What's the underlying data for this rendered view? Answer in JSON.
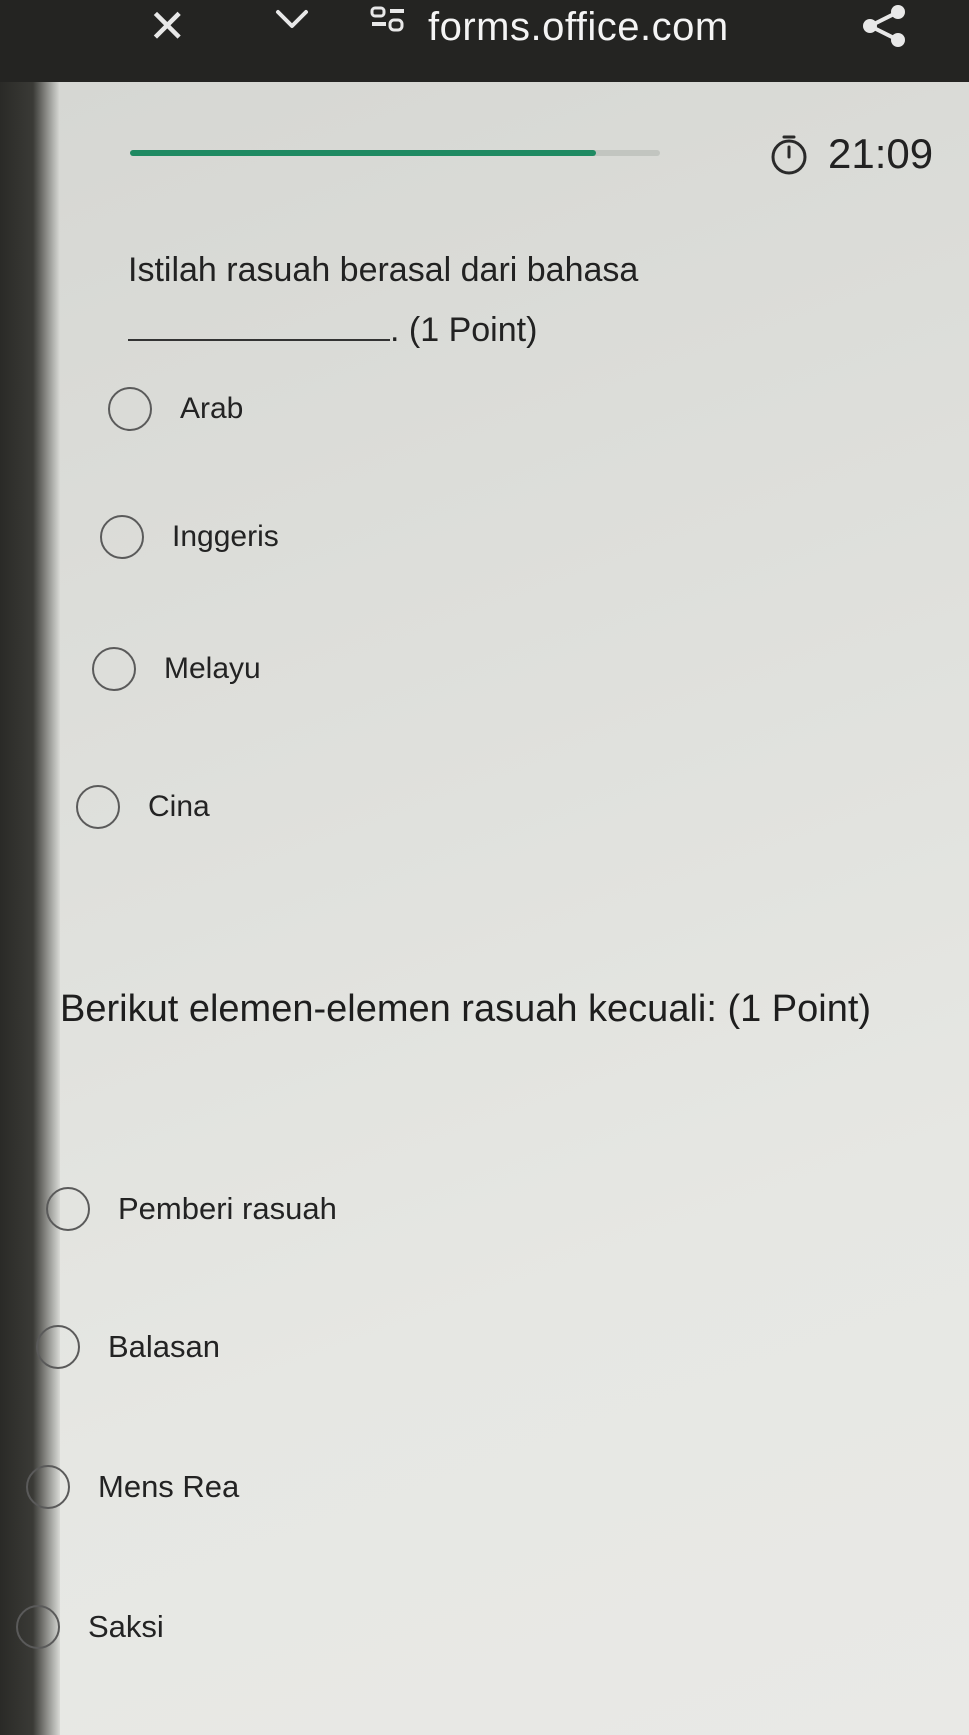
{
  "browser": {
    "url": "forms.office.com",
    "close_icon": "close-icon",
    "chevron_icon": "chevron-down-icon",
    "tabs_icon": "tab-switcher-icon",
    "share_icon": "share-icon"
  },
  "form": {
    "progress_fraction": 0.88,
    "timer": {
      "icon": "stopwatch-icon",
      "value": "21:09"
    },
    "questions": [
      {
        "text_before": "Istilah rasuah berasal dari bahasa",
        "text_after": ". (1 Point)",
        "options": [
          "Arab",
          "Inggeris",
          "Melayu",
          "Cina"
        ]
      },
      {
        "text": "Berikut elemen-elemen rasuah kecuali: (1 Point)",
        "options": [
          "Pemberi rasuah",
          "Balasan",
          "Mens Rea",
          "Saksi"
        ]
      }
    ]
  },
  "colors": {
    "accent": "#1f8a62",
    "browser_bar": "#242422",
    "page_background": "#dfe0dc"
  }
}
